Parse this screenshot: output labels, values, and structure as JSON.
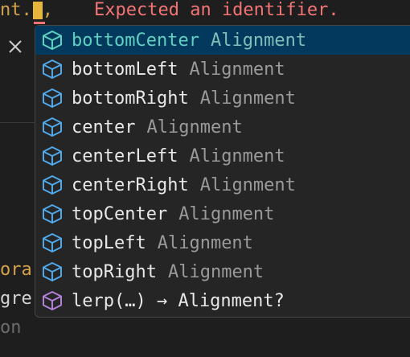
{
  "editor": {
    "top_line_text": "nt.",
    "top_line_comma": ",",
    "error_message": "Expected an identifier.",
    "side_lines": [
      "ora",
      "gre",
      "on"
    ]
  },
  "suggestions": [
    {
      "label": "bottomCenter",
      "detail": "Alignment",
      "icon": "class-icon",
      "selected": true
    },
    {
      "label": "bottomLeft",
      "detail": "Alignment",
      "icon": "class-icon",
      "selected": false
    },
    {
      "label": "bottomRight",
      "detail": "Alignment",
      "icon": "class-icon",
      "selected": false
    },
    {
      "label": "center",
      "detail": "Alignment",
      "icon": "class-icon",
      "selected": false
    },
    {
      "label": "centerLeft",
      "detail": "Alignment",
      "icon": "class-icon",
      "selected": false
    },
    {
      "label": "centerRight",
      "detail": "Alignment",
      "icon": "class-icon",
      "selected": false
    },
    {
      "label": "topCenter",
      "detail": "Alignment",
      "icon": "class-icon",
      "selected": false
    },
    {
      "label": "topLeft",
      "detail": "Alignment",
      "icon": "class-icon",
      "selected": false
    },
    {
      "label": "topRight",
      "detail": "Alignment",
      "icon": "class-icon",
      "selected": false
    },
    {
      "label": "lerp(…) → Alignment?",
      "detail": "",
      "icon": "method-icon",
      "selected": false
    }
  ],
  "colors": {
    "class_icon": "#4fa8e8",
    "class_icon_selected": "#5fd1c0",
    "method_icon": "#b180d7",
    "error": "#f27474",
    "selected_bg": "#04395e"
  }
}
